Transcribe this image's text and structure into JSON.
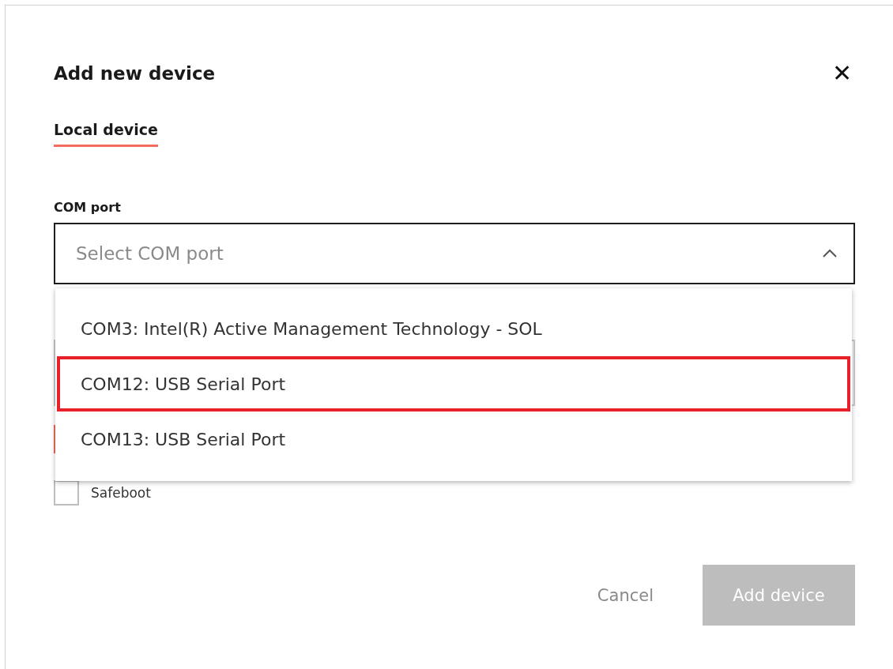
{
  "dialog": {
    "title": "Add new device",
    "close_label": "✕"
  },
  "tabs": [
    {
      "label": "Local device",
      "selected": true
    }
  ],
  "com_port": {
    "label": "COM port",
    "placeholder": "Select COM port",
    "expanded": true,
    "options": [
      {
        "label": "COM3: Intel(R) Active Management Technology - SOL",
        "selected": false
      },
      {
        "label": "COM12: USB Serial Port",
        "selected": true
      },
      {
        "label": "COM13: USB Serial Port",
        "selected": false
      }
    ]
  },
  "safeboot": {
    "label": "Safeboot",
    "checked": false
  },
  "buttons": [
    {
      "label": "Cancel",
      "kind": "text",
      "disabled": false
    },
    {
      "label": "Add device",
      "kind": "primary",
      "disabled": true
    }
  ]
}
